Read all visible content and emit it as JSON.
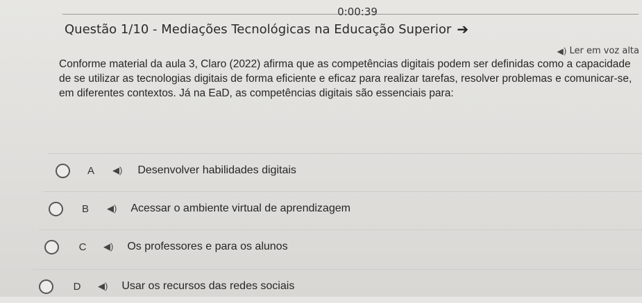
{
  "timer": "0:00:39",
  "question": {
    "title": "Questão 1/10 - Mediações Tecnológicas na Educação Superior",
    "next_icon": "arrow-right-icon",
    "read_aloud_label": "Ler em voz alta",
    "speaker_icon": "speaker-icon",
    "text": "Conforme material da aula 3, Claro (2022) afirma que as competências digitais podem ser definidas como a capacidade de se utilizar as tecnologias digitais de forma eficiente e eficaz para realizar tarefas, resolver problemas e comunicar-se, em diferentes contextos. Já na EaD, as competências digitais são essenciais para:"
  },
  "options": [
    {
      "letter": "A",
      "text": "Desenvolver habilidades digitais"
    },
    {
      "letter": "B",
      "text": "Acessar o ambiente virtual de aprendizagem"
    },
    {
      "letter": "C",
      "text": "Os professores e para os alunos"
    },
    {
      "letter": "D",
      "text": "Usar os recursos das redes sociais"
    }
  ]
}
